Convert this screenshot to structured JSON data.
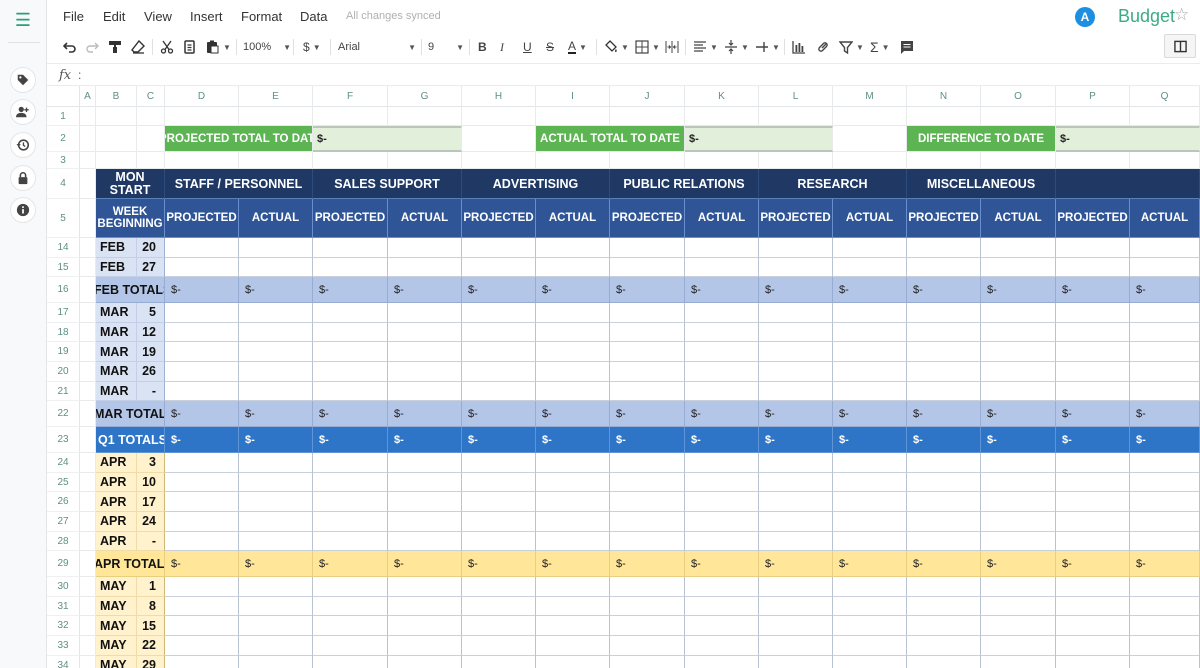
{
  "app": {
    "menu": [
      "File",
      "Edit",
      "View",
      "Insert",
      "Format",
      "Data"
    ],
    "sync_status": "All changes synced",
    "user_initial": "A",
    "doc_title": "Budget"
  },
  "toolbar": {
    "zoom": "100%",
    "currency": "$",
    "font": "Arial",
    "font_size": "9"
  },
  "formula_bar": {
    "fx_label": "fx",
    "separator": ":",
    "value": ""
  },
  "sidebar": {
    "icons": [
      "tag-icon",
      "add-user-icon",
      "history-icon",
      "lock-icon",
      "info-icon"
    ]
  },
  "columns": [
    "A",
    "B",
    "C",
    "D",
    "E",
    "F",
    "G",
    "H",
    "I",
    "J",
    "K",
    "L",
    "M",
    "N",
    "O",
    "P",
    "Q"
  ],
  "summary": {
    "projected_label": "PROJECTED TOTAL TO DATE",
    "projected_value": "$-",
    "actual_label": "ACTUAL TOTAL TO DATE",
    "actual_value": "$-",
    "difference_label": "DIFFERENCE TO DATE",
    "difference_value": "$-"
  },
  "header": {
    "mon_start": "MON START",
    "week_beginning": "WEEK BEGINNING",
    "categories": [
      "STAFF / PERSONNEL",
      "SALES SUPPORT",
      "ADVERTISING",
      "PUBLIC RELATIONS",
      "RESEARCH",
      "MISCELLANEOUS",
      ""
    ],
    "projected": "PROJECTED",
    "actual": "ACTUAL"
  },
  "rows": [
    {
      "num": "1",
      "type": "blank"
    },
    {
      "num": "2",
      "type": "summary"
    },
    {
      "num": "3",
      "type": "blank"
    },
    {
      "num": "4",
      "type": "cat-header"
    },
    {
      "num": "5",
      "type": "sub-header"
    },
    {
      "num": "14",
      "type": "week",
      "month": "FEB",
      "day": "20",
      "tone": "blue"
    },
    {
      "num": "15",
      "type": "week",
      "month": "FEB",
      "day": "27",
      "tone": "blue"
    },
    {
      "num": "16",
      "type": "month-total",
      "label": "FEB TOTALS",
      "value": "$-",
      "tone": "blue"
    },
    {
      "num": "17",
      "type": "week",
      "month": "MAR",
      "day": "5",
      "tone": "blue"
    },
    {
      "num": "18",
      "type": "week",
      "month": "MAR",
      "day": "12",
      "tone": "blue"
    },
    {
      "num": "19",
      "type": "week",
      "month": "MAR",
      "day": "19",
      "tone": "blue"
    },
    {
      "num": "20",
      "type": "week",
      "month": "MAR",
      "day": "26",
      "tone": "blue"
    },
    {
      "num": "21",
      "type": "week",
      "month": "MAR",
      "day": "-",
      "tone": "blue"
    },
    {
      "num": "22",
      "type": "month-total",
      "label": "MAR TOTALS",
      "value": "$-",
      "tone": "blue"
    },
    {
      "num": "23",
      "type": "quarter-total",
      "label": "Q1 TOTALS",
      "value": "$-"
    },
    {
      "num": "24",
      "type": "week",
      "month": "APR",
      "day": "3",
      "tone": "peach"
    },
    {
      "num": "25",
      "type": "week",
      "month": "APR",
      "day": "10",
      "tone": "peach"
    },
    {
      "num": "26",
      "type": "week",
      "month": "APR",
      "day": "17",
      "tone": "peach"
    },
    {
      "num": "27",
      "type": "week",
      "month": "APR",
      "day": "24",
      "tone": "peach"
    },
    {
      "num": "28",
      "type": "week",
      "month": "APR",
      "day": "-",
      "tone": "peach"
    },
    {
      "num": "29",
      "type": "month-total",
      "label": "APR TOTALS",
      "value": "$-",
      "tone": "peach"
    },
    {
      "num": "30",
      "type": "week",
      "month": "MAY",
      "day": "1",
      "tone": "peach"
    },
    {
      "num": "31",
      "type": "week",
      "month": "MAY",
      "day": "8",
      "tone": "peach"
    },
    {
      "num": "32",
      "type": "week",
      "month": "MAY",
      "day": "15",
      "tone": "peach"
    },
    {
      "num": "33",
      "type": "week",
      "month": "MAY",
      "day": "22",
      "tone": "peach"
    },
    {
      "num": "34",
      "type": "week",
      "month": "MAY",
      "day": "29",
      "tone": "peach"
    }
  ]
}
